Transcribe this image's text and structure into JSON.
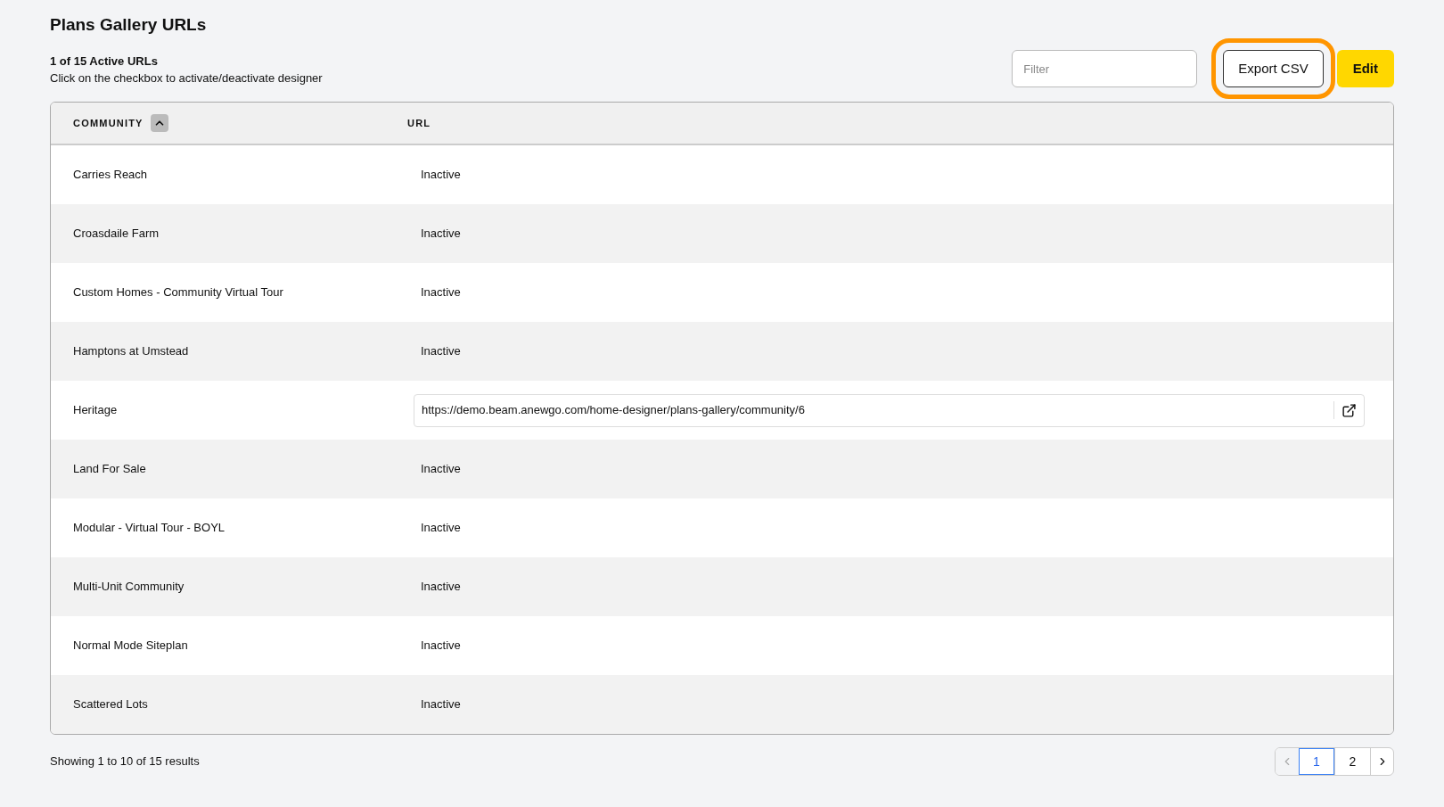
{
  "page": {
    "title": "Plans Gallery URLs",
    "summary": "1 of 15 Active URLs",
    "hint": "Click on the checkbox to activate/deactivate designer"
  },
  "toolbar": {
    "filter": {
      "placeholder": "Filter"
    },
    "export_button": {
      "label": "Export CSV",
      "highlighted": true
    },
    "edit_button": {
      "label": "Edit"
    }
  },
  "table": {
    "columns": [
      {
        "label": "COMMUNITY",
        "sorted": true
      },
      {
        "label": "URL",
        "sorted": false
      }
    ],
    "rows": [
      {
        "community": "Carries Reach",
        "kind": "status",
        "url": "Inactive"
      },
      {
        "community": "Croasdaile Farm",
        "kind": "status",
        "url": "Inactive"
      },
      {
        "community": "Custom Homes - Community Virtual Tour",
        "kind": "status",
        "url": "Inactive"
      },
      {
        "community": "Hamptons at Umstead",
        "kind": "status",
        "url": "Inactive"
      },
      {
        "community": "Heritage",
        "kind": "link",
        "url": "https://demo.beam.anewgo.com/home-designer/plans-gallery/community/6"
      },
      {
        "community": "Land For Sale",
        "kind": "status",
        "url": "Inactive"
      },
      {
        "community": "Modular - Virtual Tour - BOYL",
        "kind": "status",
        "url": "Inactive"
      },
      {
        "community": "Multi-Unit Community",
        "kind": "status",
        "url": "Inactive"
      },
      {
        "community": "Normal Mode Siteplan",
        "kind": "status",
        "url": "Inactive"
      },
      {
        "community": "Scattered Lots",
        "kind": "status",
        "url": "Inactive"
      }
    ]
  },
  "footer": {
    "results": "Showing 1 to 10 of 15 results",
    "pages": [
      {
        "label": "1",
        "selected": true
      },
      {
        "label": "2",
        "selected": false
      }
    ]
  }
}
